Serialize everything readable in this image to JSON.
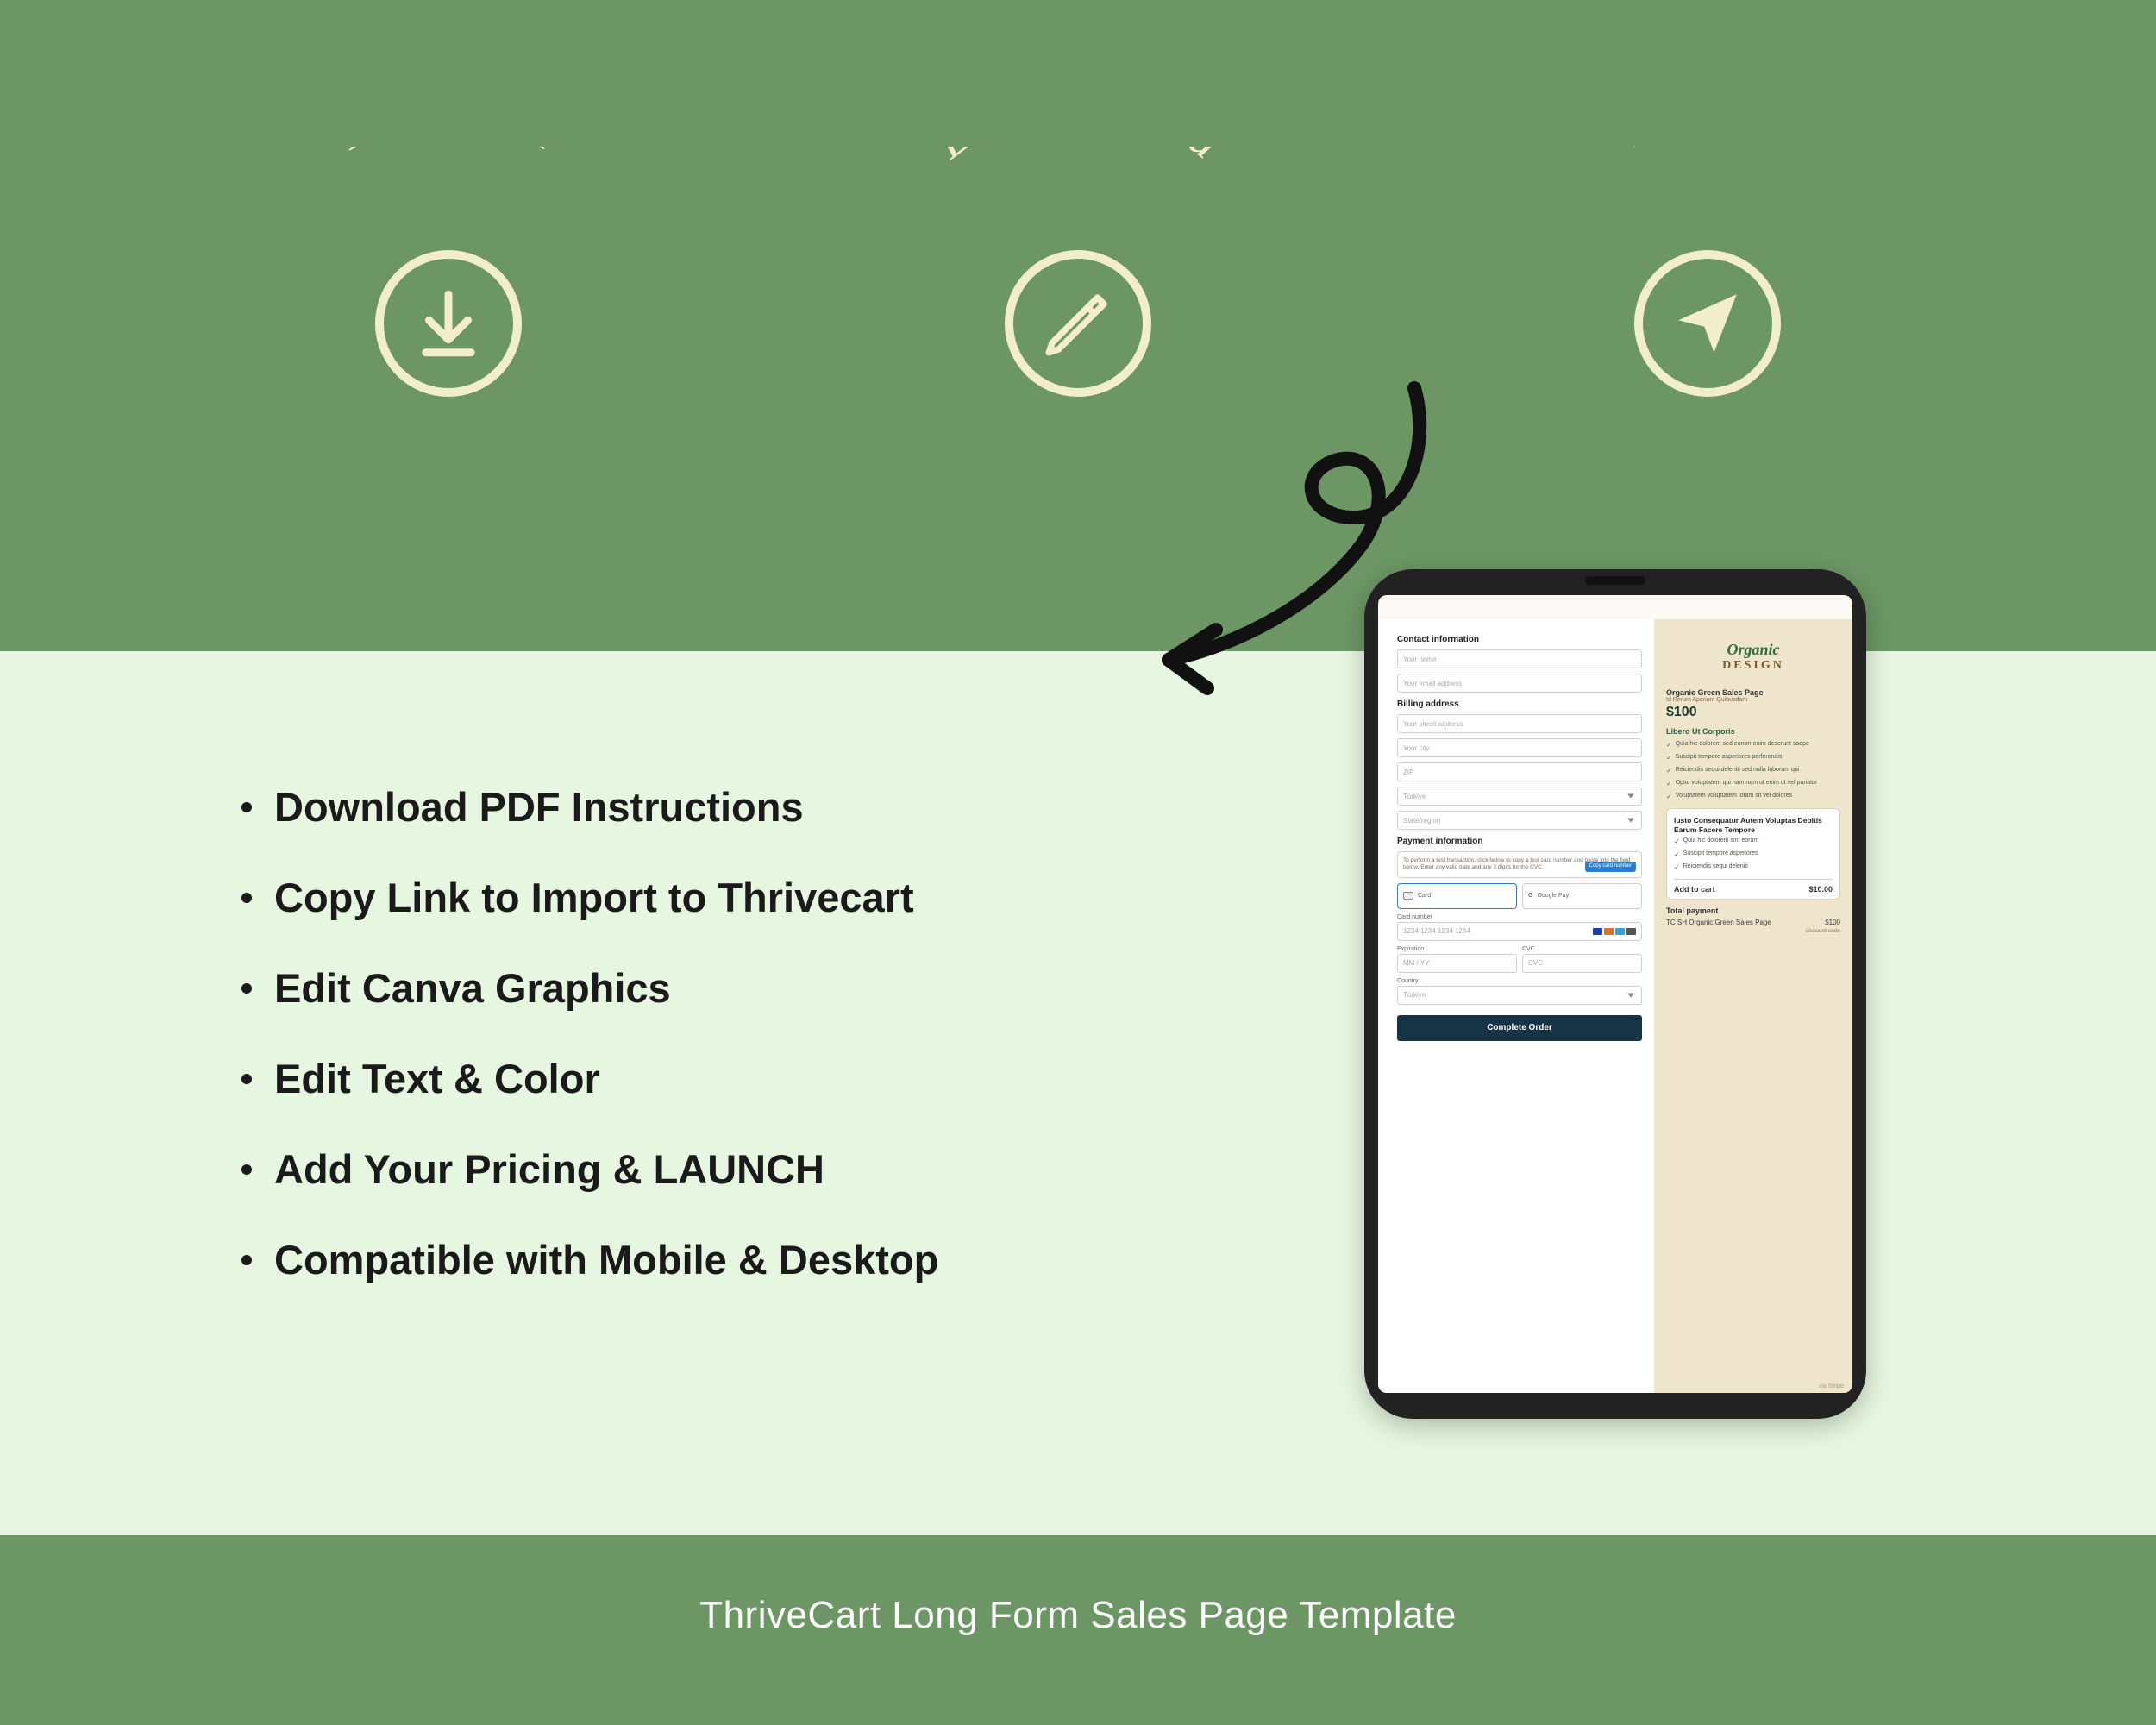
{
  "steps": {
    "download": "Download",
    "edit": "Edit in Canva",
    "publish": "Publish"
  },
  "bullets": [
    "Download PDF Instructions",
    "Copy Link to Import to Thrivecart",
    "Edit Canva Graphics",
    "Edit Text & Color",
    "Add Your Pricing & LAUNCH",
    "Compatible with Mobile & Desktop"
  ],
  "footer": "ThriveCart Long Form Sales Page Template",
  "tablet": {
    "left": {
      "contact_title": "Contact information",
      "name_ph": "Your name",
      "email_ph": "Your email address",
      "billing_title": "Billing address",
      "street_ph": "Your street address",
      "city_ph": "Your city",
      "zip_ph": "ZIP",
      "country": "Türkiye",
      "state_ph": "State/region",
      "payment_title": "Payment information",
      "test_note": "To perform a test transaction, click below to copy a test card number and paste into the field below. Enter any valid date and any 3 digits for the CVC.",
      "test_btn": "Copy card number",
      "tab_card": "Card",
      "tab_gpay": "Google Pay",
      "card_label": "Card number",
      "card_ph": "1234 1234 1234 1234",
      "exp_label": "Expiration",
      "exp_ph": "MM / YY",
      "cvc_label": "CVC",
      "cvc_ph": "CVC",
      "country_label": "Country",
      "order_btn": "Complete Order"
    },
    "right": {
      "logo1": "Organic",
      "logo2": "DESIGN",
      "product": "Organic Green Sales Page",
      "subtitle": "Id Rerum Aperiam Quibusdam",
      "price": "$100",
      "libero": "Libero Ut Corporis",
      "features": [
        "Quia hic dolorem sed eorum enim deserunt saepe",
        "Suscipit tempore asperiores perferendis",
        "Reiciendis sequi deleniti sed nulla laborum qui",
        "Optio voluptatem qui nam nam ut enim ut vel pariatur",
        "Voluptatem voluptatem totam sit vel dolores"
      ],
      "upsell_title": "Iusto Consequatur Autem Voluptas Debitis Earum Facere Tempore",
      "upsell_items": [
        "Quia hic dolorem sint eorum",
        "Suscipit tempore asperiores",
        "Reiciendis sequi deleniti"
      ],
      "addcart_label": "Add to cart",
      "addcart_price": "$10.00",
      "total_title": "Total payment",
      "line_item": "TC SH Organic Green Sales Page",
      "line_price": "$100",
      "discount": "discount code",
      "stripe": "via Stripe"
    }
  }
}
